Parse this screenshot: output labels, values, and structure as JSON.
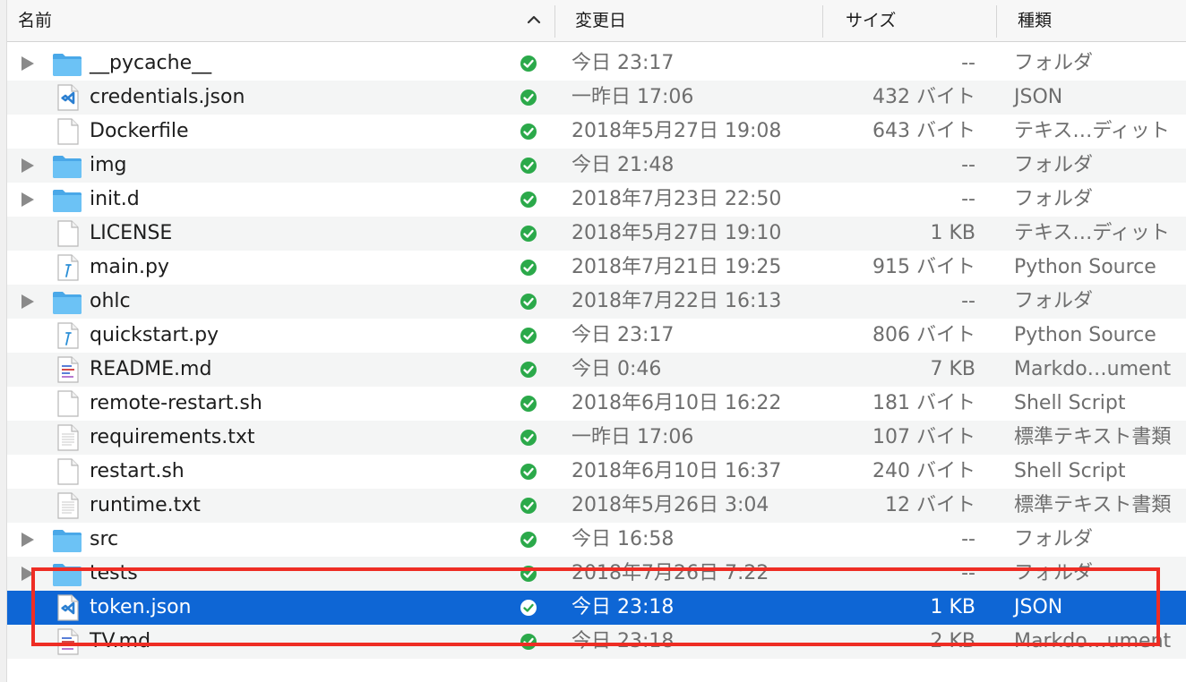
{
  "columns": {
    "name": "名前",
    "date": "変更日",
    "size": "サイズ",
    "kind": "種類"
  },
  "colors": {
    "selection": "#0e66d5",
    "annotation": "#ee2d24",
    "status_ok": "#2ba94a",
    "folder": "#5cb8f0"
  },
  "files": [
    {
      "name": "__pycache__",
      "date": "今日 23:17",
      "size": "--",
      "kind": "フォルダ",
      "icon": "folder-icon",
      "expandable": true
    },
    {
      "name": "credentials.json",
      "date": "一昨日 17:06",
      "size": "432 バイト",
      "kind": "JSON",
      "icon": "vscode-file-icon",
      "expandable": false
    },
    {
      "name": "Dockerfile",
      "date": "2018年5月27日 19:08",
      "size": "643 バイト",
      "kind": "テキス…ディット",
      "icon": "document-icon",
      "expandable": false
    },
    {
      "name": "img",
      "date": "今日 21:48",
      "size": "--",
      "kind": "フォルダ",
      "icon": "folder-icon",
      "expandable": true
    },
    {
      "name": "init.d",
      "date": "2018年7月23日 22:50",
      "size": "--",
      "kind": "フォルダ",
      "icon": "folder-icon",
      "expandable": true
    },
    {
      "name": "LICENSE",
      "date": "2018年5月27日 19:10",
      "size": "1 KB",
      "kind": "テキス…ディット",
      "icon": "document-icon",
      "expandable": false
    },
    {
      "name": "main.py",
      "date": "2018年7月21日 19:25",
      "size": "915 バイト",
      "kind": "Python Source",
      "icon": "python-file-icon",
      "expandable": false
    },
    {
      "name": "ohlc",
      "date": "2018年7月22日 16:13",
      "size": "--",
      "kind": "フォルダ",
      "icon": "folder-icon",
      "expandable": true
    },
    {
      "name": "quickstart.py",
      "date": "今日 23:17",
      "size": "806 バイト",
      "kind": "Python Source",
      "icon": "python-file-icon",
      "expandable": false
    },
    {
      "name": "README.md",
      "date": "今日 0:46",
      "size": "7 KB",
      "kind": "Markdo…ument",
      "icon": "markdown-file-icon",
      "expandable": false
    },
    {
      "name": "remote-restart.sh",
      "date": "2018年6月10日 16:22",
      "size": "181 バイト",
      "kind": "Shell Script",
      "icon": "document-icon",
      "expandable": false
    },
    {
      "name": "requirements.txt",
      "date": "一昨日 17:06",
      "size": "107 バイト",
      "kind": "標準テキスト書類",
      "icon": "text-file-icon",
      "expandable": false
    },
    {
      "name": "restart.sh",
      "date": "2018年6月10日 16:37",
      "size": "240 バイト",
      "kind": "Shell Script",
      "icon": "document-icon",
      "expandable": false
    },
    {
      "name": "runtime.txt",
      "date": "2018年5月26日 3:04",
      "size": "12 バイト",
      "kind": "標準テキスト書類",
      "icon": "text-file-icon",
      "expandable": false
    },
    {
      "name": "src",
      "date": "今日 16:58",
      "size": "--",
      "kind": "フォルダ",
      "icon": "folder-icon",
      "expandable": true
    },
    {
      "name": "tests",
      "date": "2018年7月26日 7:22",
      "size": "--",
      "kind": "フォルダ",
      "icon": "folder-icon",
      "expandable": true
    },
    {
      "name": "token.json",
      "date": "今日 23:18",
      "size": "1 KB",
      "kind": "JSON",
      "icon": "vscode-file-icon",
      "expandable": false,
      "selected": true
    },
    {
      "name": "TV.md",
      "date": "今日 23:18",
      "size": "2 KB",
      "kind": "Markdo…ument",
      "icon": "markdown-file-icon",
      "expandable": false
    }
  ]
}
